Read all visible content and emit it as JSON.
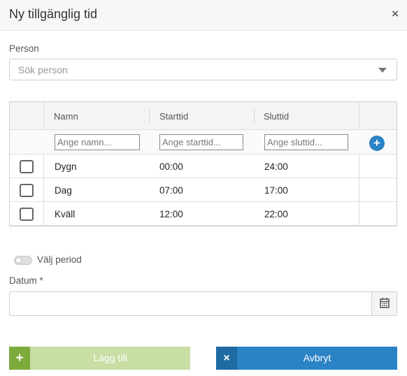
{
  "dialog": {
    "title": "Ny tillgänglig tid",
    "close_icon": "×"
  },
  "person": {
    "label": "Person",
    "placeholder": "Sök person"
  },
  "grid": {
    "columns": [
      "Namn",
      "Starttid",
      "Sluttid"
    ],
    "filters": {
      "name_placeholder": "Ange namn...",
      "start_placeholder": "Ange starttid...",
      "end_placeholder": "Ange sluttid..."
    },
    "add_icon": "+",
    "rows": [
      {
        "name": "Dygn",
        "start": "00:00",
        "end": "24:00",
        "checked": false
      },
      {
        "name": "Dag",
        "start": "07:00",
        "end": "17:00",
        "checked": false
      },
      {
        "name": "Kväll",
        "start": "12:00",
        "end": "22:00",
        "checked": false
      }
    ]
  },
  "period": {
    "label": "Välj period",
    "enabled": false
  },
  "date": {
    "label": "Datum *",
    "value": ""
  },
  "buttons": {
    "add_label": "Lägg till",
    "add_icon": "+",
    "cancel_label": "Avbryt",
    "cancel_icon": "×"
  },
  "colors": {
    "primary": "#2a83c5",
    "add_green": "#7cab3c",
    "add_green_light": "#c8dea5"
  }
}
